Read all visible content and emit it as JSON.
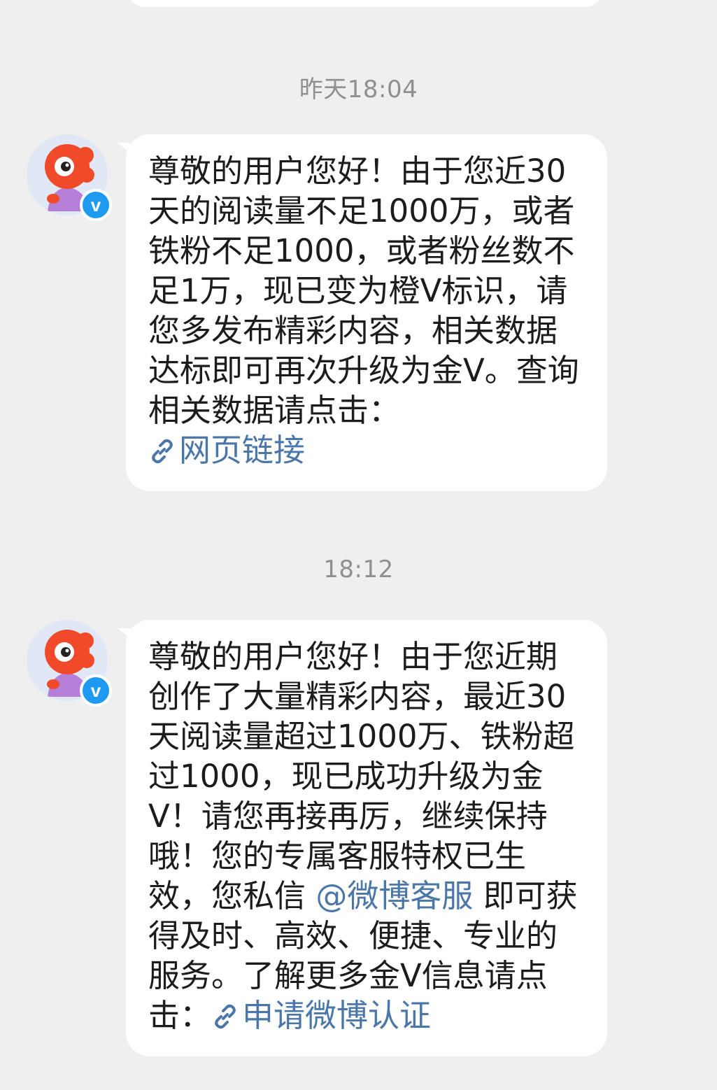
{
  "messages": [
    {
      "timestamp": "昨天18:04",
      "text": "尊敬的用户您好！由于您近30天的阅读量不足1000万，或者铁粉不足1000，或者粉丝数不足1万，现已变为橙V标识，请您多发布精彩内容，相关数据达标即可再次升级为金V。查询相关数据请点击：",
      "link_label": "网页链接",
      "verified_badge": "v"
    },
    {
      "timestamp": "18:12",
      "text_part1": "尊敬的用户您好！由于您近期创作了大量精彩内容，最近30天阅读量超过1000万、铁粉超过1000，现已成功升级为金V！请您再接再厉，继续保持哦！您的专属客服特权已生效，您私信 ",
      "mention": "@微博客服",
      "text_part2": " 即可获得及时、高效、便捷、专业的服务。了解更多金V信息请点击：",
      "link_label": "申请微博认证",
      "verified_badge": "v"
    }
  ],
  "colors": {
    "background": "#efefef",
    "bubble": "#ffffff",
    "link": "#4a76a8",
    "timestamp": "#8f8f8f",
    "verified": "#1e9bf0",
    "mascot": "#f04a2a"
  },
  "icons": {
    "avatar": "weibo-mascot-avatar",
    "badge": "verified-v-badge",
    "link": "link-chain-icon"
  }
}
